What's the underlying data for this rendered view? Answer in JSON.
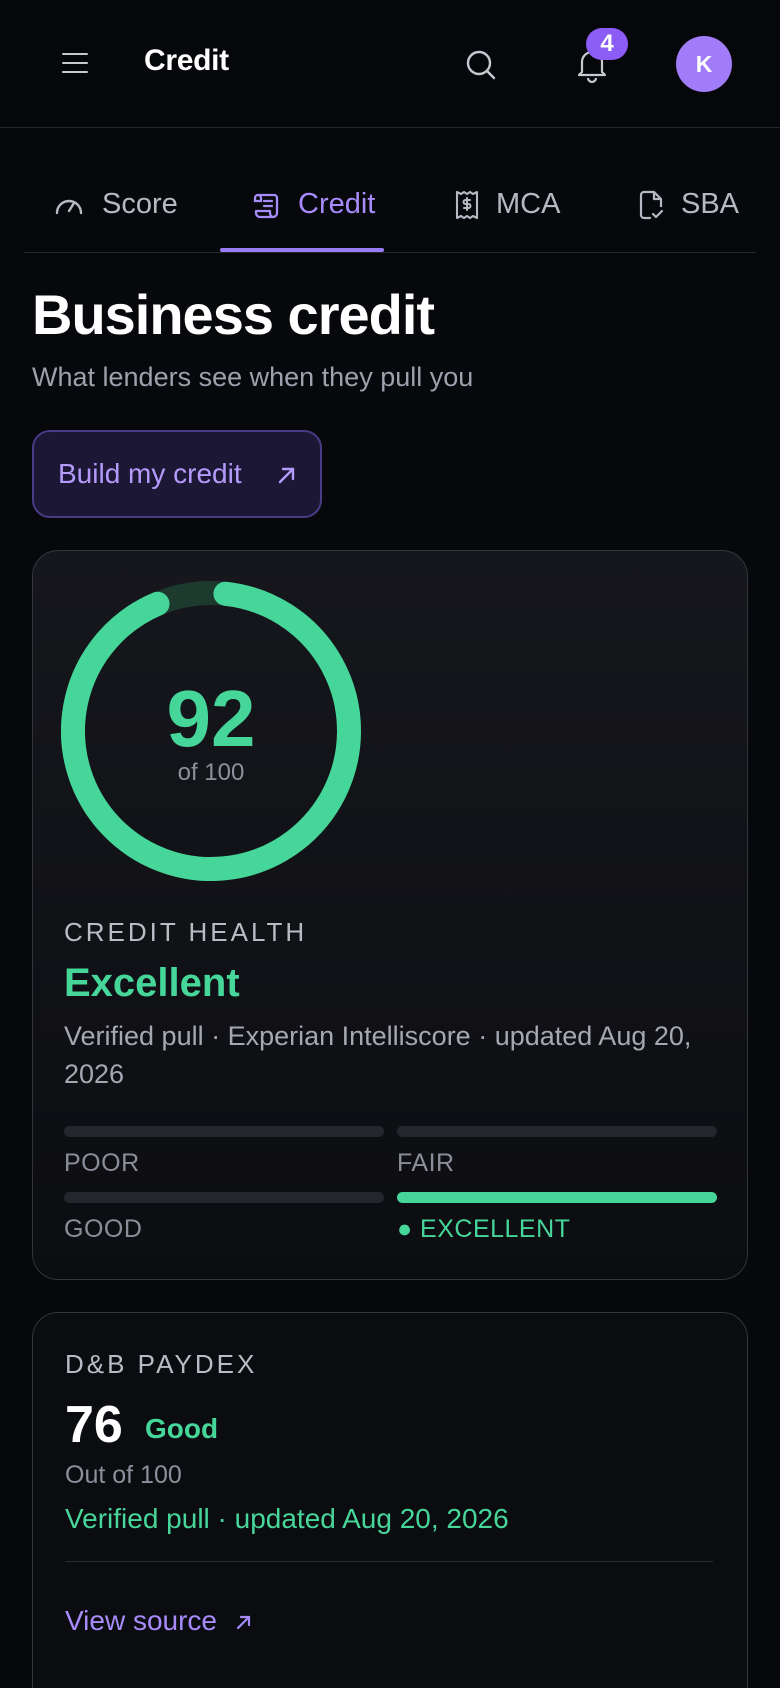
{
  "header": {
    "title": "Credit",
    "notification_count": "4",
    "avatar_initial": "K"
  },
  "tabs": [
    {
      "label": "Score",
      "icon": "gauge-icon",
      "active": false
    },
    {
      "label": "Credit",
      "icon": "scroll-icon",
      "active": true
    },
    {
      "label": "MCA",
      "icon": "receipt-dollar-icon",
      "active": false
    },
    {
      "label": "SBA",
      "icon": "file-check-icon",
      "active": false
    }
  ],
  "page": {
    "title": "Business credit",
    "subtitle": "What lenders see when they pull you",
    "build_button": "Build my credit"
  },
  "health_card": {
    "score": "92",
    "score_value": 92,
    "score_max_label": "of 100",
    "eyebrow": "CREDIT HEALTH",
    "status": "Excellent",
    "description": "Verified pull · Experian Intelliscore · updated Aug 20, 2026",
    "bands": [
      {
        "label": "POOR",
        "active": false
      },
      {
        "label": "FAIR",
        "active": false
      },
      {
        "label": "GOOD",
        "active": false
      },
      {
        "label": "● EXCELLENT",
        "active": true
      }
    ]
  },
  "paydex_card": {
    "eyebrow": "D&B PAYDEX",
    "score": "76",
    "rating": "Good",
    "out_of": "Out of 100",
    "verified": "Verified pull · updated Aug 20, 2026",
    "link": "View source"
  },
  "colors": {
    "accent": "#9b7cf8",
    "success": "#46d69a",
    "background": "#07080c"
  }
}
